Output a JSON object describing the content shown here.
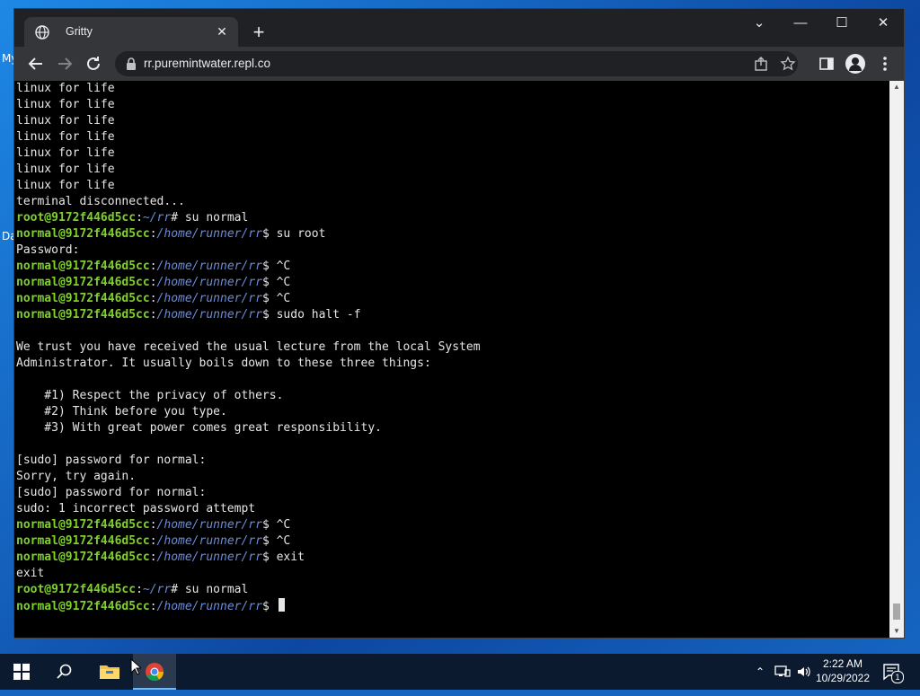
{
  "desktop": {
    "label_1": "My",
    "label_2": "Da"
  },
  "browser": {
    "tab_title": "Gritty",
    "tab_close": "✕",
    "new_tab": "+",
    "url": "rr.puremintwater.repl.co",
    "controls": {
      "minimize": "—",
      "maximize": "☐",
      "close": "✕",
      "tablist": "⌄"
    }
  },
  "terminal": {
    "lines": [
      {
        "plain": "linux for life"
      },
      {
        "plain": "linux for life"
      },
      {
        "plain": "linux for life"
      },
      {
        "plain": "linux for life"
      },
      {
        "plain": "linux for life"
      },
      {
        "plain": "linux for life"
      },
      {
        "plain": "linux for life"
      },
      {
        "plain": "terminal disconnected..."
      },
      {
        "user": "root@9172f446d5cc",
        "sep": ":",
        "path": "~/rr",
        "sym": "# ",
        "cmd": "su normal"
      },
      {
        "user": "normal@9172f446d5cc",
        "sep": ":",
        "path": "/home/runner/rr",
        "sym": "$ ",
        "cmd": "su root"
      },
      {
        "plain": "Password:"
      },
      {
        "user": "normal@9172f446d5cc",
        "sep": ":",
        "path": "/home/runner/rr",
        "sym": "$ ",
        "cmd": "^C"
      },
      {
        "user": "normal@9172f446d5cc",
        "sep": ":",
        "path": "/home/runner/rr",
        "sym": "$ ",
        "cmd": "^C"
      },
      {
        "user": "normal@9172f446d5cc",
        "sep": ":",
        "path": "/home/runner/rr",
        "sym": "$ ",
        "cmd": "^C"
      },
      {
        "user": "normal@9172f446d5cc",
        "sep": ":",
        "path": "/home/runner/rr",
        "sym": "$ ",
        "cmd": "sudo halt -f"
      },
      {
        "plain": ""
      },
      {
        "plain": "We trust you have received the usual lecture from the local System"
      },
      {
        "plain": "Administrator. It usually boils down to these three things:"
      },
      {
        "plain": ""
      },
      {
        "plain": "    #1) Respect the privacy of others."
      },
      {
        "plain": "    #2) Think before you type."
      },
      {
        "plain": "    #3) With great power comes great responsibility."
      },
      {
        "plain": ""
      },
      {
        "plain": "[sudo] password for normal:"
      },
      {
        "plain": "Sorry, try again."
      },
      {
        "plain": "[sudo] password for normal:"
      },
      {
        "plain": "sudo: 1 incorrect password attempt"
      },
      {
        "user": "normal@9172f446d5cc",
        "sep": ":",
        "path": "/home/runner/rr",
        "sym": "$ ",
        "cmd": "^C"
      },
      {
        "user": "normal@9172f446d5cc",
        "sep": ":",
        "path": "/home/runner/rr",
        "sym": "$ ",
        "cmd": "^C"
      },
      {
        "user": "normal@9172f446d5cc",
        "sep": ":",
        "path": "/home/runner/rr",
        "sym": "$ ",
        "cmd": "exit"
      },
      {
        "plain": "exit"
      },
      {
        "user": "root@9172f446d5cc",
        "sep": ":",
        "path": "~/rr",
        "sym": "# ",
        "cmd": "su normal"
      },
      {
        "user": "normal@9172f446d5cc",
        "sep": ":",
        "path": "/home/runner/rr",
        "sym": "$ ",
        "cmd": "",
        "cursor": true
      }
    ]
  },
  "taskbar": {
    "time": "2:22 AM",
    "date": "10/29/2022",
    "notification_count": "1"
  },
  "colors": {
    "prompt_user": "#7fd12a",
    "prompt_path": "#6b8cd8",
    "terminal_bg": "#000000"
  }
}
